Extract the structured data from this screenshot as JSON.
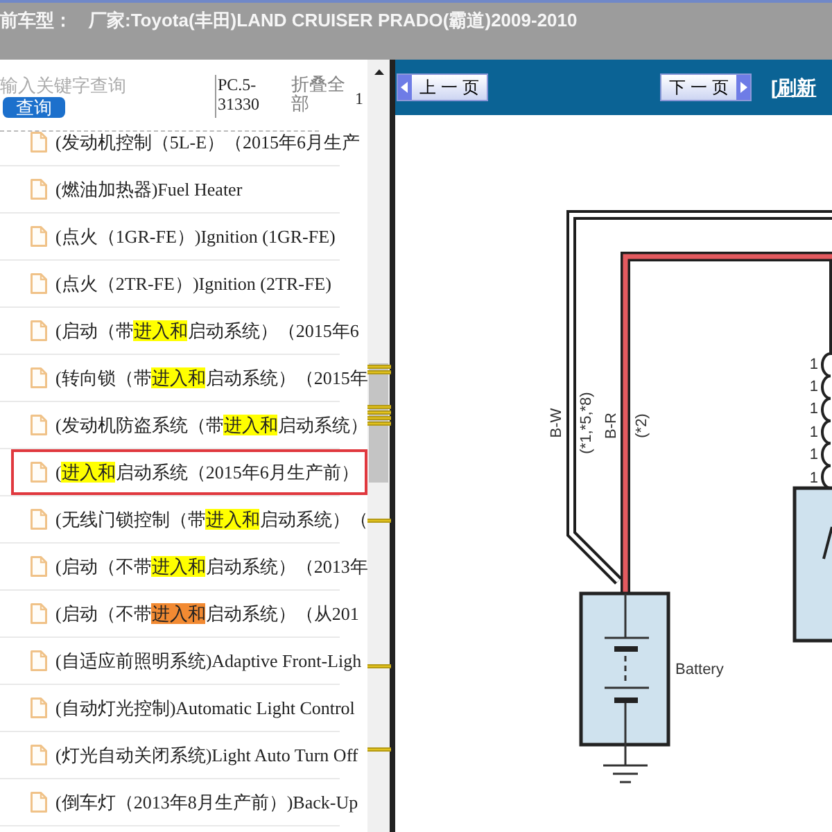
{
  "header": {
    "label": "前车型：",
    "vehicle": "厂家:Toyota(丰田)LAND CRUISER PRADO(霸道)2009-2010"
  },
  "sidebar": {
    "search": {
      "placeholder": "输入关键字查询"
    },
    "search_button": "查询",
    "code": "PC.5-31330",
    "collapse_all": "折叠全部",
    "column_4": "1",
    "items": [
      {
        "selected": false,
        "segments": [
          {
            "kind": "plain",
            "text": "(发动机控制（5L-E）（2015年6月生产"
          }
        ]
      },
      {
        "selected": false,
        "segments": [
          {
            "kind": "plain",
            "text": "(燃油加热器)Fuel Heater"
          }
        ]
      },
      {
        "selected": false,
        "segments": [
          {
            "kind": "plain",
            "text": "(点火（1GR-FE）)Ignition (1GR-FE)"
          }
        ]
      },
      {
        "selected": false,
        "segments": [
          {
            "kind": "plain",
            "text": "(点火（2TR-FE）)Ignition (2TR-FE)"
          }
        ]
      },
      {
        "selected": false,
        "segments": [
          {
            "kind": "plain",
            "text": "(启动（带"
          },
          {
            "kind": "match",
            "text": "进入和"
          },
          {
            "kind": "plain",
            "text": "启动系统）（2015年6"
          }
        ]
      },
      {
        "selected": false,
        "segments": [
          {
            "kind": "plain",
            "text": "(转向锁（带"
          },
          {
            "kind": "match",
            "text": "进入和"
          },
          {
            "kind": "plain",
            "text": "启动系统）（2015年"
          }
        ]
      },
      {
        "selected": false,
        "segments": [
          {
            "kind": "plain",
            "text": "(发动机防盗系统（带"
          },
          {
            "kind": "match",
            "text": "进入和"
          },
          {
            "kind": "plain",
            "text": "启动系统）"
          }
        ]
      },
      {
        "selected": true,
        "segments": [
          {
            "kind": "plain",
            "text": "("
          },
          {
            "kind": "match",
            "text": "进入和"
          },
          {
            "kind": "plain",
            "text": "启动系统（2015年6月生产前）"
          }
        ]
      },
      {
        "selected": false,
        "segments": [
          {
            "kind": "plain",
            "text": "(无线门锁控制（带"
          },
          {
            "kind": "match",
            "text": "进入和"
          },
          {
            "kind": "plain",
            "text": "启动系统）（"
          }
        ]
      },
      {
        "selected": false,
        "segments": [
          {
            "kind": "plain",
            "text": "(启动（不带"
          },
          {
            "kind": "match",
            "text": "进入和"
          },
          {
            "kind": "plain",
            "text": "启动系统）（2013年"
          }
        ]
      },
      {
        "selected": false,
        "segments": [
          {
            "kind": "plain",
            "text": "(启动（不带"
          },
          {
            "kind": "current",
            "text": "进入和"
          },
          {
            "kind": "plain",
            "text": "启动系统）（从201"
          }
        ]
      },
      {
        "selected": false,
        "segments": [
          {
            "kind": "plain",
            "text": "(自适应前照明系统)Adaptive Front-Ligh"
          }
        ]
      },
      {
        "selected": false,
        "segments": [
          {
            "kind": "plain",
            "text": "(自动灯光控制)Automatic Light Control"
          }
        ]
      },
      {
        "selected": false,
        "segments": [
          {
            "kind": "plain",
            "text": "(灯光自动关闭系统)Light Auto Turn Off"
          }
        ]
      },
      {
        "selected": false,
        "segments": [
          {
            "kind": "plain",
            "text": "(倒车灯（2013年8月生产前）)Back-Up"
          }
        ]
      }
    ]
  },
  "viewer": {
    "prev_button": "上 一 页",
    "next_button": "下 一 页",
    "refresh_link": "[刷新",
    "diagram": {
      "wires": [
        {
          "label": "B-W",
          "note": "(*1,*5,*8)",
          "color": "#ffffff"
        },
        {
          "label": "B-R",
          "note": "(*2)",
          "color": "#e35a5f"
        }
      ],
      "coil_labels": [
        "1",
        "1",
        "1",
        "1",
        "1",
        "1"
      ],
      "battery_label": "Battery"
    }
  }
}
